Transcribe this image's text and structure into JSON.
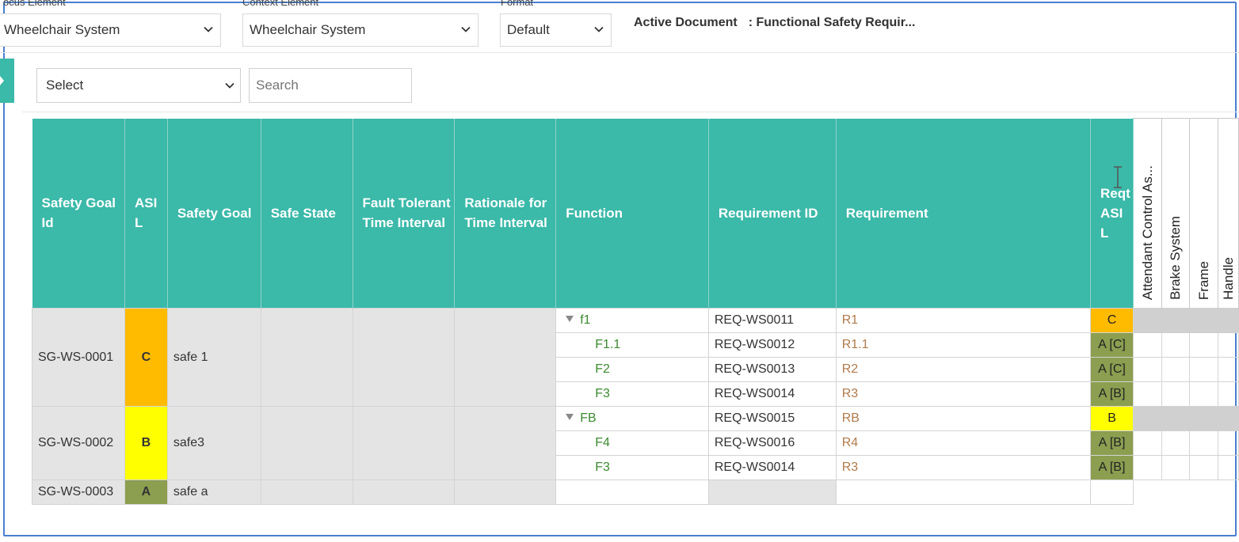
{
  "toolbar": {
    "focus_label": "ocus Element",
    "focus_value": "Wheelchair System",
    "context_label": "Context Element",
    "context_value": "Wheelchair System",
    "format_label": "Format",
    "format_value": "Default",
    "active_doc_label": "Active Document",
    "active_doc_value": ": Functional Safety Requir..."
  },
  "filter": {
    "select_value": "Select",
    "search_placeholder": "Search"
  },
  "table": {
    "headers": {
      "goal_id": "Safety Goal Id",
      "asil": "ASI L",
      "safety_goal": "Safety Goal",
      "safe_state": "Safe State",
      "ftti": "Fault Tolerant Time Interval",
      "rationale": "Rationale for Time Interval",
      "function": "Function",
      "req_id": "Requirement ID",
      "requirement": "Requirement",
      "reqt_asil": "Reqt ASI L",
      "m1": "Attendant Control As...",
      "m2": "Brake System",
      "m3": "Frame",
      "m4": "Handle"
    },
    "goals": [
      {
        "id": "SG-WS-0001",
        "asil": "C",
        "goal": "safe 1"
      },
      {
        "id": "SG-WS-0002",
        "asil": "B",
        "goal": "safe3"
      },
      {
        "id": "SG-WS-0003",
        "asil": "A",
        "goal": "safe a"
      }
    ],
    "rows": [
      {
        "function": "f1",
        "req_id": "REQ-WS0011",
        "req": "R1",
        "reqt_asil": "C"
      },
      {
        "function": "F1.1",
        "req_id": "REQ-WS0012",
        "req": "R1.1",
        "reqt_asil": "A [C]"
      },
      {
        "function": "F2",
        "req_id": "REQ-WS0013",
        "req": "R2",
        "reqt_asil": "A [C]"
      },
      {
        "function": "F3",
        "req_id": "REQ-WS0014",
        "req": "R3",
        "reqt_asil": "A [B]"
      },
      {
        "function": "FB",
        "req_id": "REQ-WS0015",
        "req": "RB",
        "reqt_asil": "B"
      },
      {
        "function": "F4",
        "req_id": "REQ-WS0016",
        "req": "R4",
        "reqt_asil": "A [B]"
      },
      {
        "function": "F3",
        "req_id": "REQ-WS0014",
        "req": "R3",
        "reqt_asil": "A [B]"
      }
    ]
  },
  "colors": {
    "header_teal": "#3bb9a9",
    "asil_c": "#ffbb00",
    "asil_b": "#ffff00",
    "asil_a": "#8c9e50",
    "function_green": "#3a8a2e",
    "requirement_brown": "#b07a4a",
    "frame_blue": "#4a7fd0"
  },
  "icons": [
    "chevron-down-icon",
    "expand-triangle-icon",
    "text-cursor-icon",
    "sidebar-expand-arrow-icon"
  ]
}
